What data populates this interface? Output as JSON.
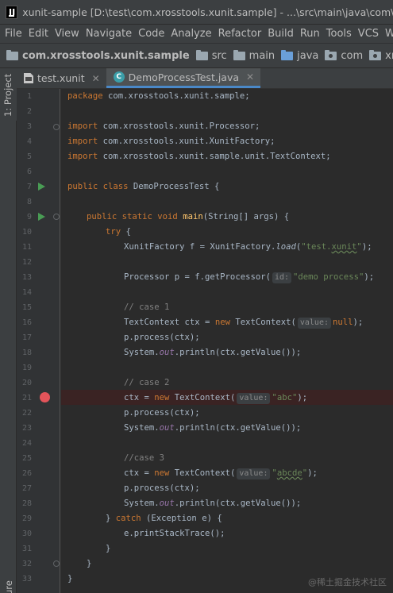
{
  "window": {
    "title": "xunit-sample [D:\\test\\com.xrosstools.xunit.sample] - ...\\src\\main\\java\\com\\xrosstools"
  },
  "menu": {
    "items": [
      "File",
      "Edit",
      "View",
      "Navigate",
      "Code",
      "Analyze",
      "Refactor",
      "Build",
      "Run",
      "Tools",
      "VCS",
      "W"
    ]
  },
  "breadcrumb": {
    "items": [
      "com.xrosstools.xunit.sample",
      "src",
      "main",
      "java",
      "com",
      "xrossto"
    ]
  },
  "side_tabs": {
    "project": "1: Project",
    "bottom": "ure"
  },
  "tabs": [
    {
      "label": "test.xunit",
      "active": false
    },
    {
      "label": "DemoProcessTest.java",
      "active": true
    }
  ],
  "editor": {
    "line_numbers": [
      "1",
      "2",
      "3",
      "4",
      "5",
      "6",
      "7",
      "8",
      "9",
      "10",
      "11",
      "12",
      "13",
      "14",
      "15",
      "16",
      "17",
      "18",
      "19",
      "20",
      "21",
      "22",
      "23",
      "24",
      "25",
      "26",
      "27",
      "28",
      "29",
      "30",
      "31",
      "32",
      "33"
    ],
    "lines": {
      "l1_kw": "package",
      "l1_rest": " com.xrosstools.xunit.sample;",
      "l3_kw": "import",
      "l3_rest": " com.xrosstools.xunit.Processor;",
      "l4_kw": "import",
      "l4_rest": " com.xrosstools.xunit.XunitFactory;",
      "l5_kw": "import",
      "l5_rest": " com.xrosstools.xunit.sample.unit.TextContext;",
      "l7_kw": "public class",
      "l7_rest": " DemoProcessTest {",
      "l9_kw": "public static void",
      "l9_fn": "main",
      "l9_rest": "(String[] args) {",
      "l10_kw": "try",
      "l10_rest": " {",
      "l11_a": "XunitFactory f = XunitFactory.",
      "l11_fn": "load",
      "l11_b": "(",
      "l11_str1": "\"test.",
      "l11_str2": "xunit",
      "l11_str3": "\"",
      "l11_c": ");",
      "l13_a": "Processor p = f.getProcessor(",
      "l13_hint": "id:",
      "l13_str": "\"demo process\"",
      "l13_b": ");",
      "l15_cm": "// case 1",
      "l16_a": "TextContext ctx = ",
      "l16_kw": "new",
      "l16_b": " TextContext(",
      "l16_hint": "value:",
      "l16_kw2": "null",
      "l16_c": ");",
      "l17": "p.process(ctx);",
      "l18_a": "System.",
      "l18_fld": "out",
      "l18_b": ".println(ctx.getValue());",
      "l20_cm": "// case 2",
      "l21_a": "ctx = ",
      "l21_kw": "new",
      "l21_b": " TextContext(",
      "l21_hint": "value:",
      "l21_str": "\"abc\"",
      "l21_c": ");",
      "l22": "p.process(ctx);",
      "l23_a": "System.",
      "l23_fld": "out",
      "l23_b": ".println(ctx.getValue());",
      "l25_cm": "//case 3",
      "l26_a": "ctx = ",
      "l26_kw": "new",
      "l26_b": " TextContext(",
      "l26_hint": "value:",
      "l26_str1": "\"",
      "l26_str2": "abcde",
      "l26_str3": "\"",
      "l26_c": ");",
      "l27": "p.process(ctx);",
      "l28_a": "System.",
      "l28_fld": "out",
      "l28_b": ".println(ctx.getValue());",
      "l29_a": "} ",
      "l29_kw": "catch",
      "l29_b": " (Exception e) {",
      "l30": "e.printStackTrace();",
      "l31": "}",
      "l32": "}",
      "l33": "}"
    }
  },
  "watermark": "@稀土掘金技术社区",
  "colors": {
    "keyword": "#cc7832",
    "string": "#6a8759",
    "comment": "#808080",
    "method": "#ffc66d",
    "field": "#9876aa",
    "run_icon": "#499c54",
    "breakpoint": "#e3545a",
    "active_tab_underline": "#4a88c7"
  },
  "icons": {
    "app": "intellij-logo-icon",
    "folder": "folder-icon",
    "run": "run-gutter-icon",
    "breakpoint": "breakpoint-icon",
    "class": "java-class-icon"
  }
}
